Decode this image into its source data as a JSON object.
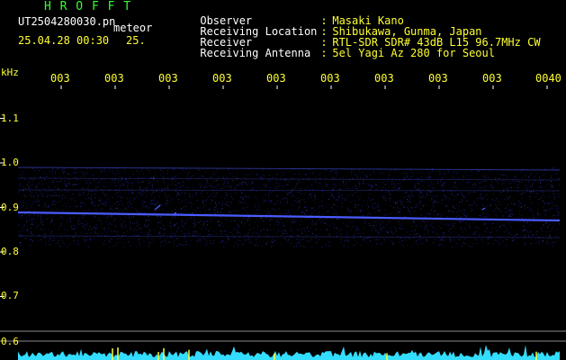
{
  "header": {
    "brand": "H R O F F T",
    "filename": "UT2504280030.pn",
    "tag": "meteor",
    "datetime": "25.04.28 00:30",
    "short_label": "25."
  },
  "info": {
    "rows": [
      {
        "field": "Observer",
        "value": "Masaki Kano"
      },
      {
        "field": "Receiving Location",
        "value": "Shibukawa, Gunma, Japan"
      },
      {
        "field": "Receiver",
        "value": "RTL-SDR SDR# 43dB L15 96.7MHz CW"
      },
      {
        "field": "Receiving Antenna",
        "value": "5el Yagi Az 280 for Seoul"
      }
    ],
    "separator": ":"
  },
  "axis": {
    "unit": "kHz",
    "time_ticks": [
      "003",
      "003",
      "003",
      "003",
      "003",
      "003",
      "003",
      "003",
      "003",
      "0040"
    ],
    "freq_ticks": [
      "1.1",
      "1.0",
      "0.9",
      "0.8",
      "0.7",
      "0.6"
    ],
    "freq_values": [
      1.1,
      1.0,
      0.9,
      0.8,
      0.7,
      0.6
    ]
  },
  "colors": {
    "background": "#000000",
    "text_yellow": "#ffff33",
    "text_white": "#ffffff",
    "brand_green": "#33ff33",
    "signal_blue": "#4a5cff",
    "noise_blue": "#1a1f8a",
    "spectrum_cyan": "#33ddff",
    "spectrum_yellow": "#ffff33"
  }
}
